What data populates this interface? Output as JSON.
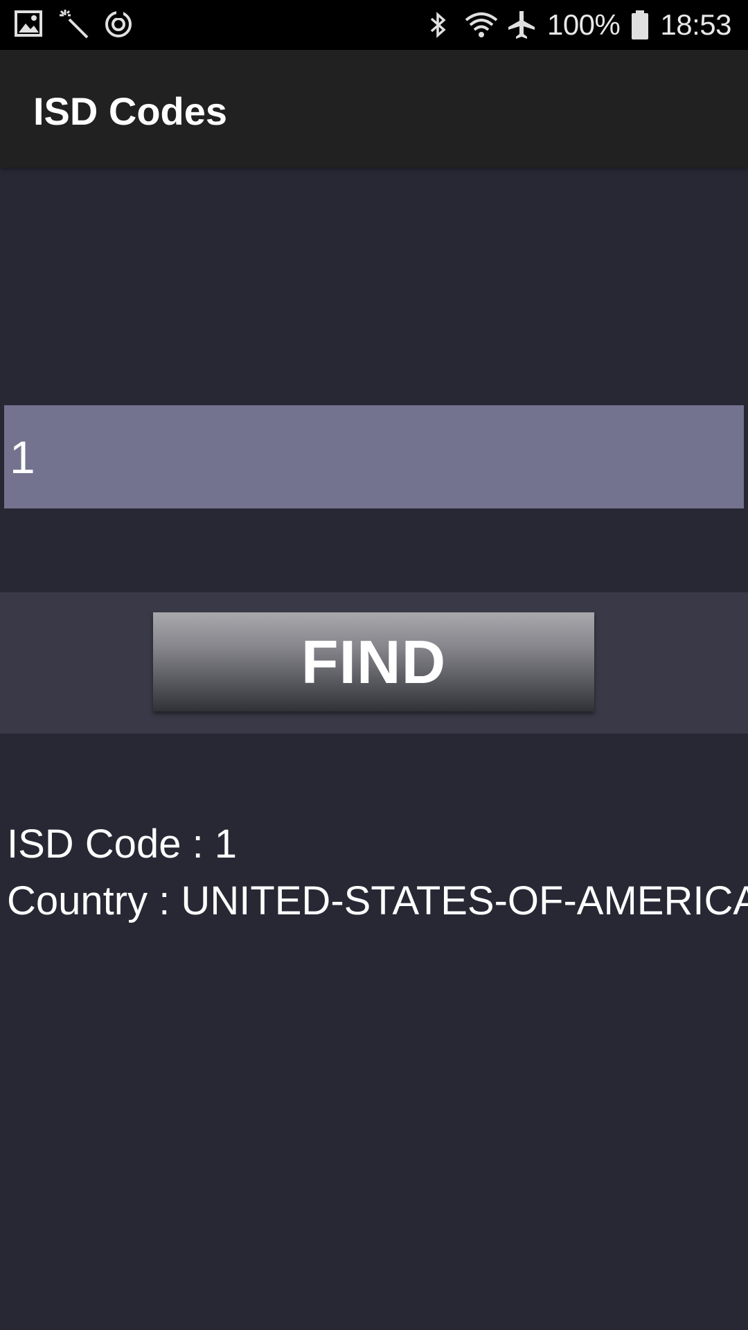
{
  "status_bar": {
    "left_icons": [
      "gallery-icon",
      "magic-wand-icon",
      "sync-icon"
    ],
    "right_icons": [
      "bluetooth-icon",
      "wifi-icon",
      "airplane-mode-icon",
      "battery-icon"
    ],
    "battery_percent": "100%",
    "time": "18:53"
  },
  "app_bar": {
    "title": "ISD Codes"
  },
  "search": {
    "value": "1",
    "placeholder": ""
  },
  "find_button": {
    "label": "FIND"
  },
  "result": {
    "isd_code_line": "ISD Code : 1",
    "country_line": "Country : UNITED-STATES-OF-AMERICA"
  },
  "colors": {
    "background": "#282835",
    "app_bar": "#212121",
    "input_background": "#73738f",
    "button_band": "#3a3947"
  }
}
